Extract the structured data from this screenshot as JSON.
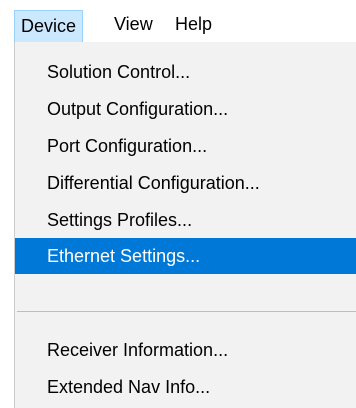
{
  "menubar": {
    "items": [
      "Device",
      "View",
      "Help"
    ]
  },
  "dropdown": {
    "items": [
      "Solution Control...",
      "Output Configuration...",
      "Port Configuration...",
      "Differential Configuration...",
      "Settings Profiles...",
      "Ethernet Settings...",
      "Receiver Information...",
      "Extended Nav Info..."
    ],
    "highlighted_item": "Ethernet Settings..."
  },
  "colors": {
    "highlight": "#0078d7",
    "menu_background": "#f2f2f2",
    "menubar_active": "#cce8ff"
  }
}
